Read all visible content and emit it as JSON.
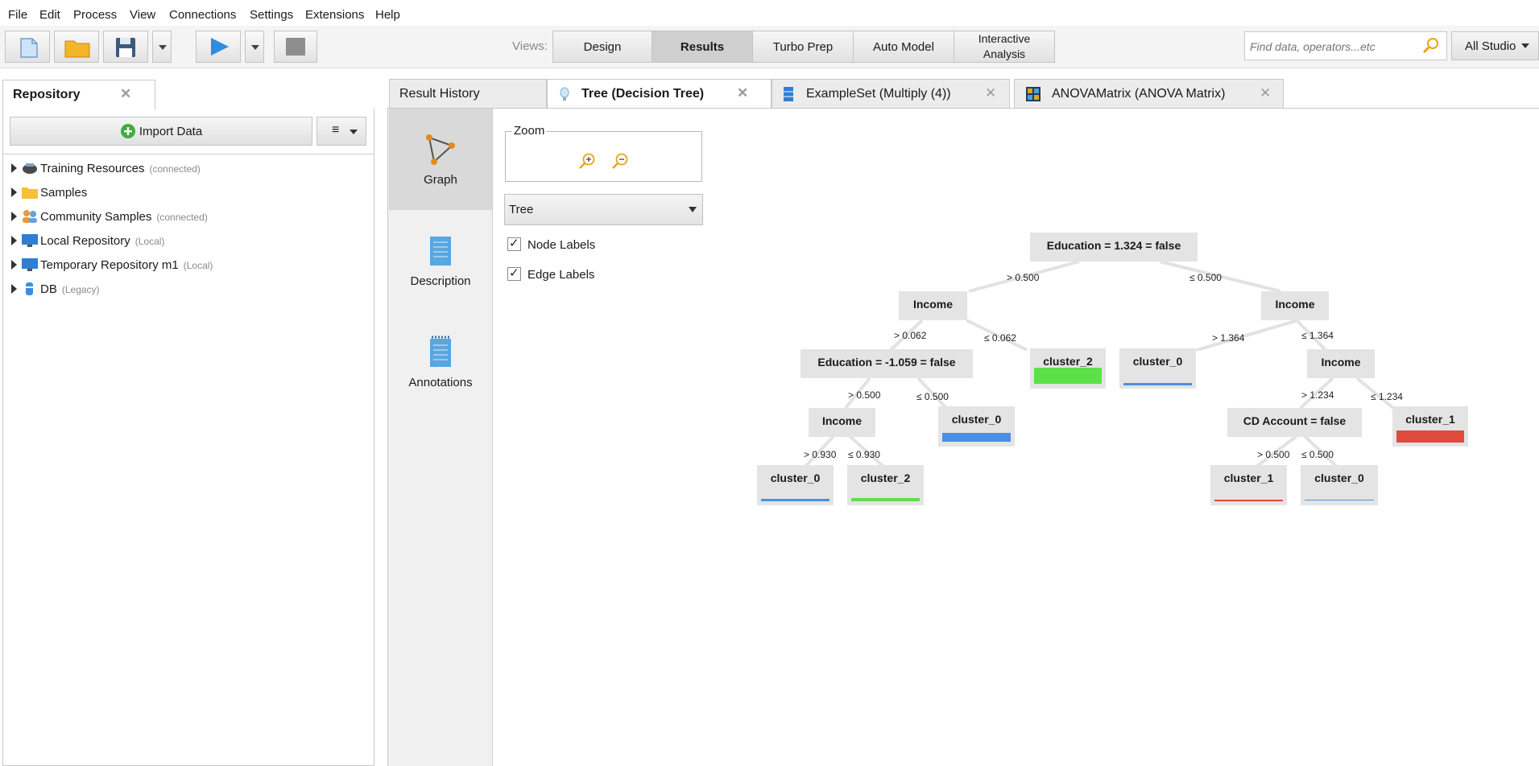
{
  "menu": [
    "File",
    "Edit",
    "Process",
    "View",
    "Connections",
    "Settings",
    "Extensions",
    "Help"
  ],
  "toolbar": {
    "views_label": "Views:",
    "views": [
      "Design",
      "Results",
      "Turbo Prep",
      "Auto Model",
      "Interactive\nAnalysis"
    ],
    "active_view": "Results",
    "search_placeholder": "Find data, operators...etc",
    "studio_label": "All Studio"
  },
  "repository": {
    "title": "Repository",
    "import_label": "Import Data",
    "items": [
      {
        "label": "Training Resources",
        "sub": "(connected)"
      },
      {
        "label": "Samples",
        "sub": ""
      },
      {
        "label": "Community Samples",
        "sub": "(connected)"
      },
      {
        "label": "Local Repository",
        "sub": "(Local)"
      },
      {
        "label": "Temporary Repository m1",
        "sub": "(Local)"
      },
      {
        "label": "DB",
        "sub": "(Legacy)"
      }
    ]
  },
  "result_tabs": [
    "Result History",
    "Tree (Decision Tree)",
    "ExampleSet (Multiply (4))",
    "ANOVAMatrix (ANOVA Matrix)"
  ],
  "active_tab": "Tree (Decision Tree)",
  "side_tools": [
    "Graph",
    "Description",
    "Annotations"
  ],
  "controls": {
    "zoom_label": "Zoom",
    "layout_select": "Tree",
    "node_labels": "Node Labels",
    "edge_labels": "Edge Labels"
  },
  "tree": {
    "nodes": [
      {
        "id": "n1",
        "label": "Education = 1.324 = false"
      },
      {
        "id": "n2",
        "label": "Income"
      },
      {
        "id": "n3",
        "label": "Income"
      },
      {
        "id": "n4",
        "label": "Education = -1.059 = false"
      },
      {
        "id": "n5",
        "label": "cluster_2"
      },
      {
        "id": "n6",
        "label": "cluster_0"
      },
      {
        "id": "n7",
        "label": "Income"
      },
      {
        "id": "n8",
        "label": "Income"
      },
      {
        "id": "n9",
        "label": "cluster_0"
      },
      {
        "id": "n10",
        "label": "CD Account = false"
      },
      {
        "id": "n11",
        "label": "cluster_1"
      },
      {
        "id": "n12",
        "label": "cluster_0"
      },
      {
        "id": "n13",
        "label": "cluster_2"
      },
      {
        "id": "n14",
        "label": "cluster_1"
      },
      {
        "id": "n15",
        "label": "cluster_0"
      }
    ],
    "edge_labels": [
      "> 0.500",
      "≤ 0.500",
      "> 0.062",
      "≤ 0.062",
      "> 1.364",
      "≤ 1.364",
      "> 0.500",
      "≤ 0.500",
      "> 1.234",
      "≤ 1.234",
      "> 0.930",
      "≤ 0.930",
      "> 0.500",
      "≤ 0.500"
    ],
    "colors": {
      "cluster_0": "#4a90e2",
      "cluster_1": "#e04a3c",
      "cluster_2": "#5ee04a"
    }
  }
}
